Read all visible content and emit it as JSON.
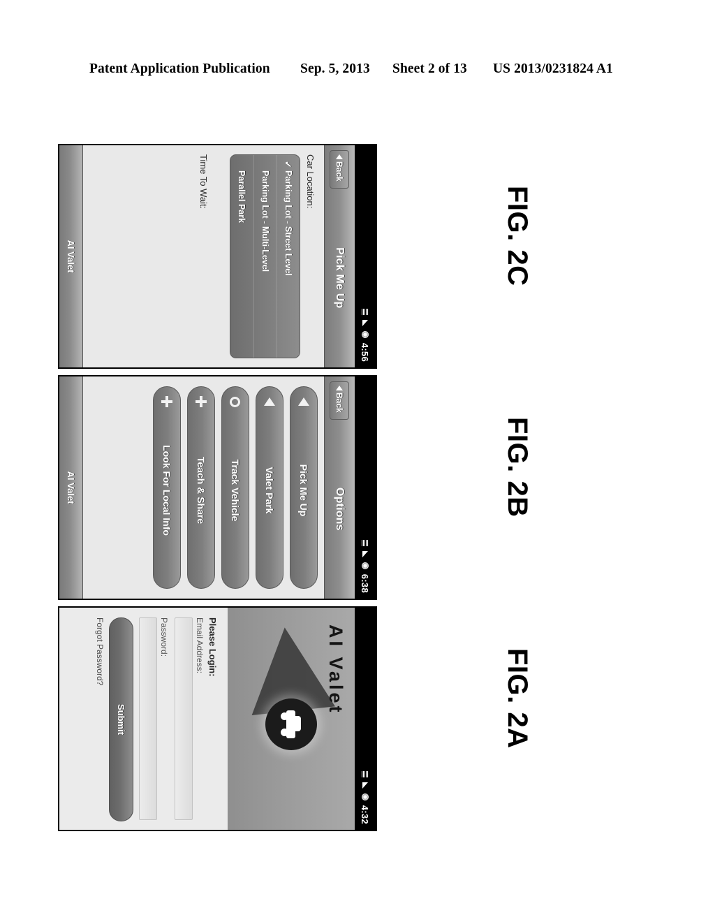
{
  "header": {
    "publication": "Patent Application Publication",
    "date": "Sep. 5, 2013",
    "sheet": "Sheet 2 of 13",
    "patent_number": "US 2013/0231824 A1"
  },
  "figures": [
    {
      "caption": "FIG. 2A",
      "screen": "login",
      "status_bar": {
        "time": "4:32",
        "icons": [
          "network-icon",
          "signal-icon",
          "battery-icon"
        ]
      },
      "hero": {
        "app_title": "AI Valet",
        "logo": "car-in-circle-icon"
      },
      "form": {
        "heading": "Please Login:",
        "email_label": "Email Address:",
        "email_value": "",
        "password_label": "Password:",
        "password_value": "",
        "submit_label": "Submit",
        "forgot_label": "Forgot Password?"
      }
    },
    {
      "caption": "FIG. 2B",
      "screen": "options",
      "status_bar": {
        "time": "6:38",
        "icons": [
          "network-icon",
          "signal-icon",
          "battery-icon"
        ]
      },
      "navbar": {
        "back_label": "Back",
        "title": "Options"
      },
      "options": [
        {
          "label": "Pick Me Up",
          "icon": "triangle-left-icon"
        },
        {
          "label": "Valet Park",
          "icon": "triangle-left-icon"
        },
        {
          "label": "Track Vehicle",
          "icon": "circle-outline-icon"
        },
        {
          "label": "Teach & Share",
          "icon": "plus-icon"
        },
        {
          "label": "Look For Local Info",
          "icon": "plus-icon"
        }
      ],
      "footer": {
        "label": "AI Valet"
      }
    },
    {
      "caption": "FIG. 2C",
      "screen": "pick-me-up",
      "status_bar": {
        "time": "4:56",
        "icons": [
          "network-icon",
          "signal-icon",
          "battery-icon"
        ]
      },
      "navbar": {
        "back_label": "Back",
        "title": "Pick Me Up"
      },
      "car_location": {
        "label": "Car Location:",
        "options": [
          {
            "label": "Parking Lot - Street Level",
            "selected": true,
            "check": "✓"
          },
          {
            "label": "Parking Lot - Multi-Level",
            "selected": false,
            "check": ""
          },
          {
            "label": "Parallel Park",
            "selected": false,
            "check": ""
          }
        ]
      },
      "time_to_wait": {
        "label": "Time To Wait:"
      },
      "footer": {
        "label": "AI Valet"
      }
    }
  ]
}
